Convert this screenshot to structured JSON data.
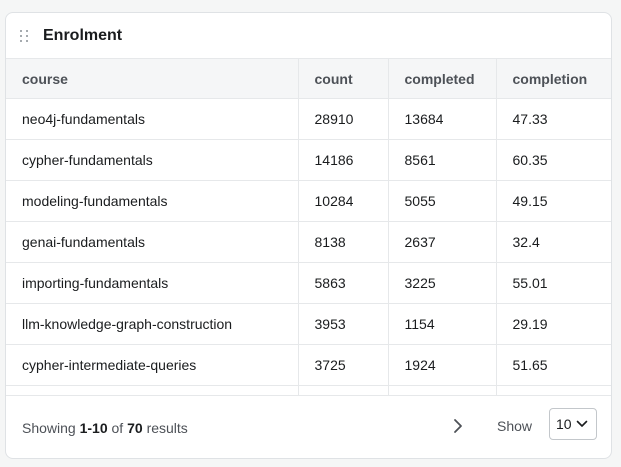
{
  "card": {
    "title": "Enrolment"
  },
  "table": {
    "columns": [
      "course",
      "count",
      "completed",
      "completion"
    ],
    "rows": [
      [
        "neo4j-fundamentals",
        "28910",
        "13684",
        "47.33"
      ],
      [
        "cypher-fundamentals",
        "14186",
        "8561",
        "60.35"
      ],
      [
        "modeling-fundamentals",
        "10284",
        "5055",
        "49.15"
      ],
      [
        "genai-fundamentals",
        "8138",
        "2637",
        "32.4"
      ],
      [
        "importing-fundamentals",
        "5863",
        "3225",
        "55.01"
      ],
      [
        "llm-knowledge-graph-construction",
        "3953",
        "1154",
        "29.19"
      ],
      [
        "cypher-intermediate-queries",
        "3725",
        "1924",
        "51.65"
      ]
    ]
  },
  "footer": {
    "showing_prefix": "Showing",
    "range": "1-10",
    "of": "of",
    "total": "70",
    "results": "results",
    "show_label": "Show",
    "page_size": "10"
  },
  "icons": {
    "drag": "drag-handle-icon",
    "next": "chevron-right-icon",
    "dropdown": "chevron-down-icon"
  }
}
